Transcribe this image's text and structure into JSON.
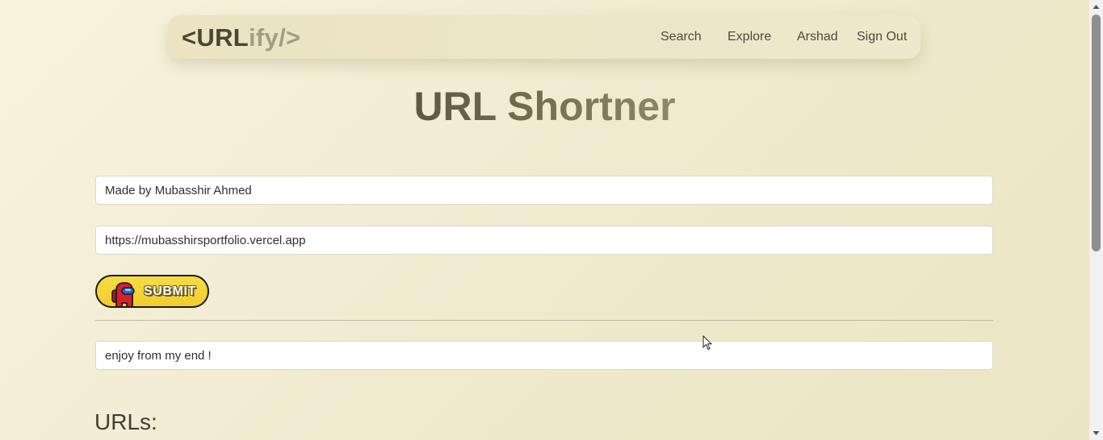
{
  "navbar": {
    "logo_part1": "<URL",
    "logo_part2": "ify/>",
    "links": {
      "search": "Search",
      "explore": "Explore",
      "user": "Arshad",
      "signout": "Sign Out"
    }
  },
  "main": {
    "title": "URL Shortner",
    "title_input_value": "Made by Mubasshir Ahmed",
    "url_input_value": "https://mubasshirsportfolio.vercel.app",
    "submit_label": "SUBMIT",
    "result_value": "enjoy from my end !",
    "urls_heading": "URLs:"
  },
  "colors": {
    "logo_dark": "#4a4632",
    "logo_light": "#a19d8a",
    "button_yellow": "#f2cd2c",
    "crewmate_red": "#d8202a",
    "visor_blue": "#1b6fcf"
  },
  "icons": {
    "button_icon": "crewmate-icon",
    "scroll_up": "scroll-up-arrow-icon",
    "scroll_down": "scroll-down-arrow-icon"
  }
}
